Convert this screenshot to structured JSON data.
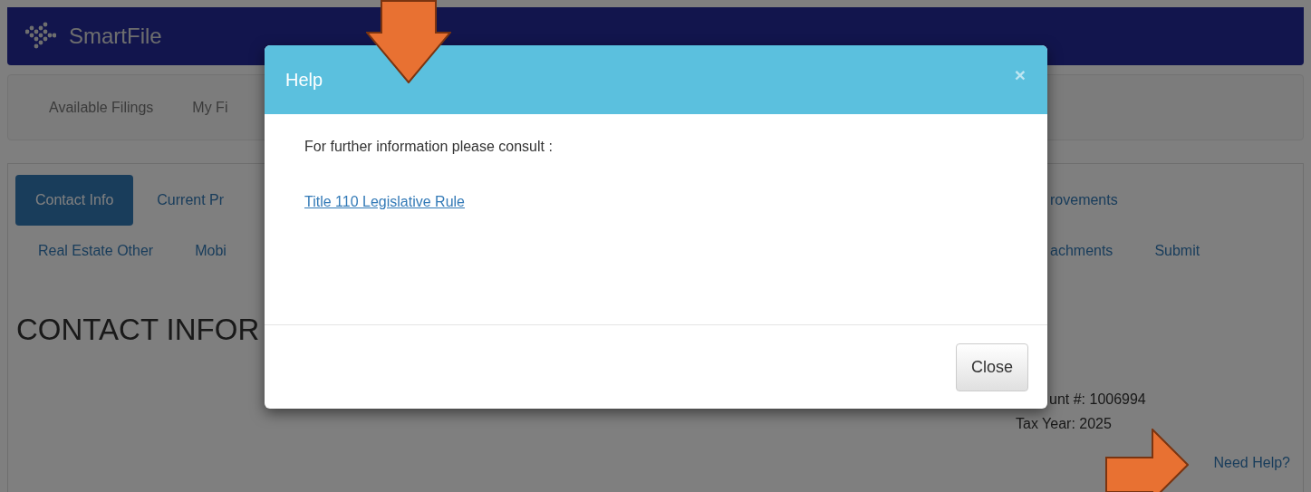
{
  "app": {
    "brand": "SmartFile"
  },
  "top_nav": [
    {
      "label": "Available Filings"
    },
    {
      "label": "My Fi"
    }
  ],
  "tab_rows": [
    {
      "left": [
        {
          "label": "Contact Info",
          "selected": true
        },
        {
          "label": "Current Pr",
          "selected": false
        }
      ],
      "right": [
        {
          "label": "rovements",
          "selected": false
        }
      ]
    },
    {
      "left": [
        {
          "label": "Real Estate Other",
          "selected": false
        },
        {
          "label": "Mobi",
          "selected": false
        }
      ],
      "right": [
        {
          "label": "achments",
          "selected": false
        },
        {
          "label": "Submit",
          "selected": false
        }
      ]
    }
  ],
  "heading": "CONTACT INFOR",
  "account_line": "unt #: 1006994",
  "tax_year": "Tax Year: 2025",
  "help_link": "Need Help?",
  "modal": {
    "title": "Help",
    "close_symbol": "×",
    "message": "For further information please consult :",
    "link": "Title 110 Legislative Rule",
    "button": "Close"
  },
  "annotations": [
    {
      "kind": "arrow-down"
    },
    {
      "kind": "arrow-right"
    }
  ]
}
